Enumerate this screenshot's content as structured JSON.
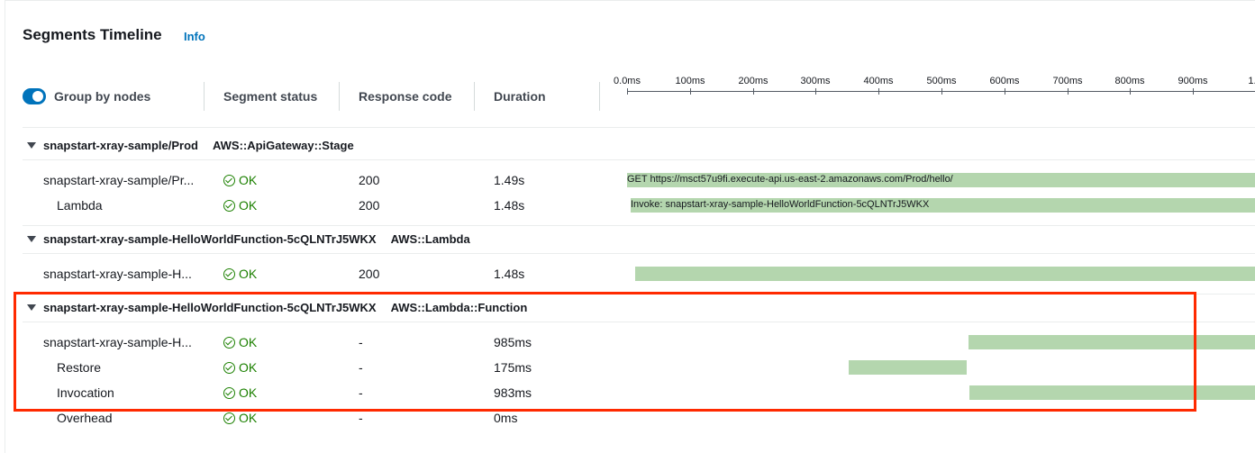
{
  "panel": {
    "title": "Segments Timeline",
    "info_label": "Info"
  },
  "columns": {
    "group_by_label": "Group by nodes",
    "group_by_enabled": true,
    "segment_status": "Segment status",
    "response_code": "Response code",
    "duration": "Duration"
  },
  "axis_ticks": [
    "0.0ms",
    "100ms",
    "200ms",
    "300ms",
    "400ms",
    "500ms",
    "600ms",
    "700ms",
    "800ms",
    "900ms",
    "1."
  ],
  "groups": [
    {
      "name": "snapstart-xray-sample/Prod",
      "type": "AWS::ApiGateway::Stage",
      "rows": [
        {
          "name": "snapstart-xray-sample/Pr...",
          "status": "OK",
          "code": "200",
          "duration": "1.49s",
          "bar_label": "GET https://msct57u9fi.execute-api.us-east-2.amazonaws.com/Prod/hello/"
        },
        {
          "name": "Lambda",
          "status": "OK",
          "code": "200",
          "duration": "1.48s",
          "bar_label": "Invoke: snapstart-xray-sample-HelloWorldFunction-5cQLNTrJ5WKX"
        }
      ]
    },
    {
      "name": "snapstart-xray-sample-HelloWorldFunction-5cQLNTrJ5WKX",
      "type": "AWS::Lambda",
      "rows": [
        {
          "name": "snapstart-xray-sample-H...",
          "status": "OK",
          "code": "200",
          "duration": "1.48s"
        }
      ]
    },
    {
      "name": "snapstart-xray-sample-HelloWorldFunction-5cQLNTrJ5WKX",
      "type": "AWS::Lambda::Function",
      "rows": [
        {
          "name": "snapstart-xray-sample-H...",
          "status": "OK",
          "code": "-",
          "duration": "985ms"
        },
        {
          "name": "Restore",
          "status": "OK",
          "code": "-",
          "duration": "175ms"
        },
        {
          "name": "Invocation",
          "status": "OK",
          "code": "-",
          "duration": "983ms"
        },
        {
          "name": "Overhead",
          "status": "OK",
          "code": "-",
          "duration": "0ms"
        }
      ]
    }
  ],
  "colors": {
    "bar": "#b4d6ae",
    "ok": "#1d8102",
    "link": "#0073bb",
    "highlight": "#ff2a00"
  }
}
